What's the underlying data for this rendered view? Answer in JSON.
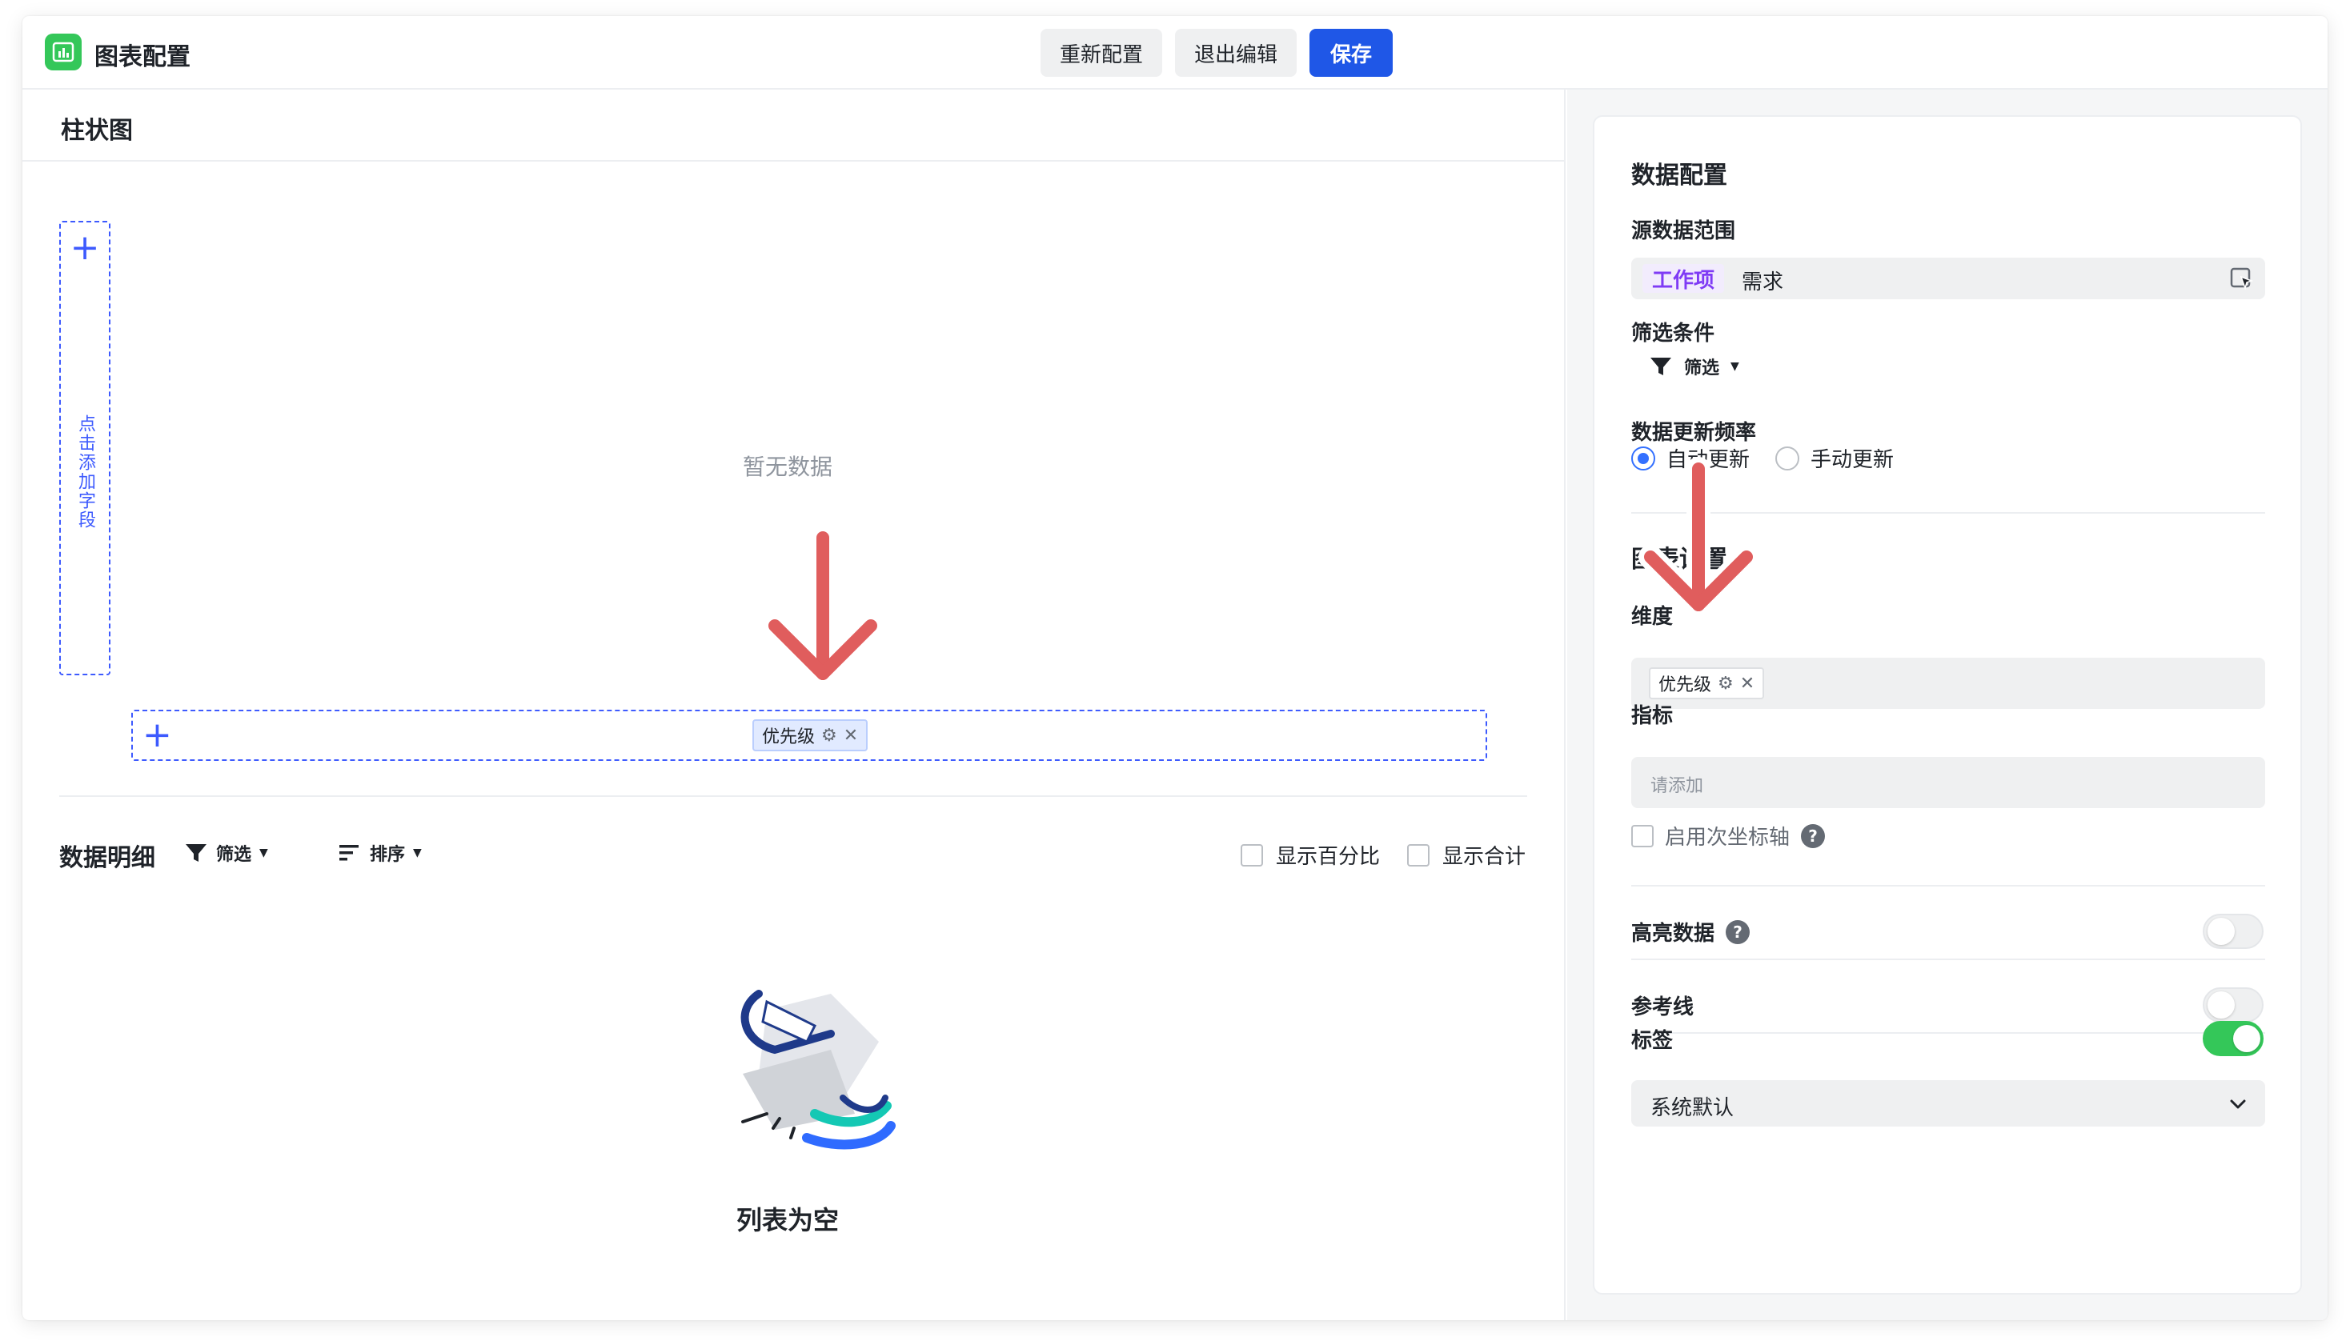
{
  "header": {
    "title": "图表配置",
    "buttons": {
      "reset": "重新配置",
      "exit": "退出编辑",
      "save": "保存"
    }
  },
  "chart": {
    "type_title": "柱状图",
    "y_axis_hint": "点击添加字段",
    "empty_text": "暂无数据",
    "x_axis_tag": "优先级"
  },
  "detail": {
    "title": "数据明细",
    "filter_label": "筛选",
    "sort_label": "排序",
    "show_percent": "显示百分比",
    "show_total": "显示合计",
    "empty_list": "列表为空"
  },
  "config": {
    "data_section_title": "数据配置",
    "source_label": "源数据范围",
    "source_type": "工作项",
    "source_value": "需求",
    "filter_section": "筛选条件",
    "filter_button": "筛选",
    "update_label": "数据更新频率",
    "auto_update": "自动更新",
    "manual_update": "手动更新",
    "chart_section_title": "图表设置",
    "dimension_label": "维度",
    "dimension_tag": "优先级",
    "metric_label": "指标",
    "metric_placeholder": "请添加",
    "secondary_axis": "启用次坐标轴",
    "highlight_label": "高亮数据",
    "highlight_on": false,
    "reference_label": "参考线",
    "reference_on": false,
    "labels_label": "标签",
    "labels_on": true,
    "labels_select_value": "系统默认"
  },
  "colors": {
    "primary": "#1f57e7",
    "accent_dashed": "#3d5afe",
    "toggle_on": "#34c759",
    "annotation_arrow": "#e05d5d",
    "work_item_tag": "#7f3bf5"
  }
}
